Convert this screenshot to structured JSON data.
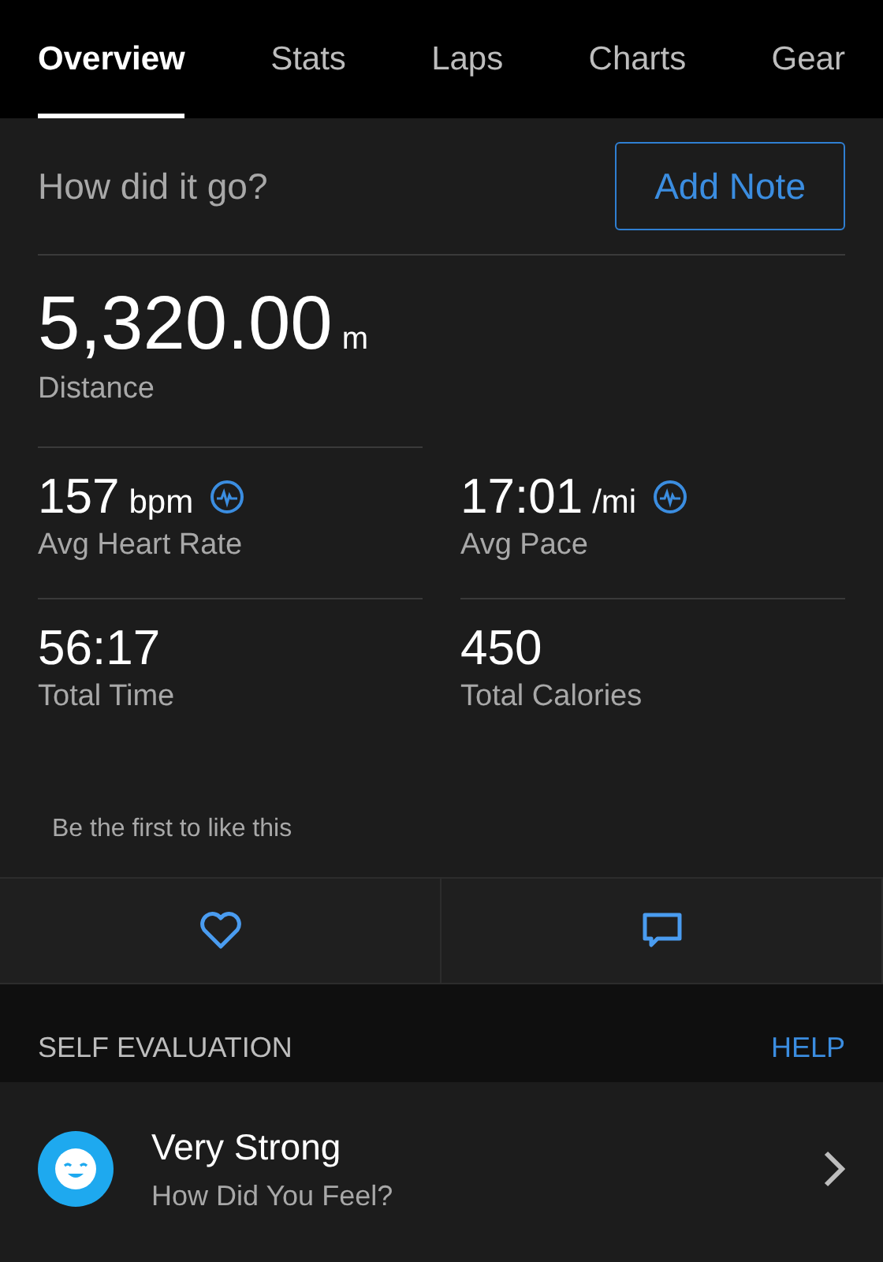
{
  "tabs": [
    {
      "label": "Overview",
      "selected": true
    },
    {
      "label": "Stats",
      "selected": false
    },
    {
      "label": "Laps",
      "selected": false
    },
    {
      "label": "Charts",
      "selected": false
    },
    {
      "label": "Gear",
      "selected": false
    }
  ],
  "note_prompt": {
    "question": "How did it go?",
    "button": "Add Note"
  },
  "distance": {
    "value": "5,320.00",
    "unit": "m",
    "label": "Distance"
  },
  "stats": [
    {
      "value": "157",
      "unit": "bpm",
      "label": "Avg Heart Rate",
      "detail": true
    },
    {
      "value": "17:01",
      "unit": "/mi",
      "label": "Avg Pace",
      "detail": true
    },
    {
      "value": "56:17",
      "label": "Total Time",
      "detail": false
    },
    {
      "value": "450",
      "label": "Total Calories",
      "detail": false
    }
  ],
  "likes_text": "Be the first to like this",
  "actions": [
    {
      "kind": "like"
    },
    {
      "kind": "comment"
    }
  ],
  "self_evaluation": {
    "header": "SELF EVALUATION",
    "help": "HELP",
    "title": "Very Strong",
    "subtitle": "How Did You Feel?"
  }
}
